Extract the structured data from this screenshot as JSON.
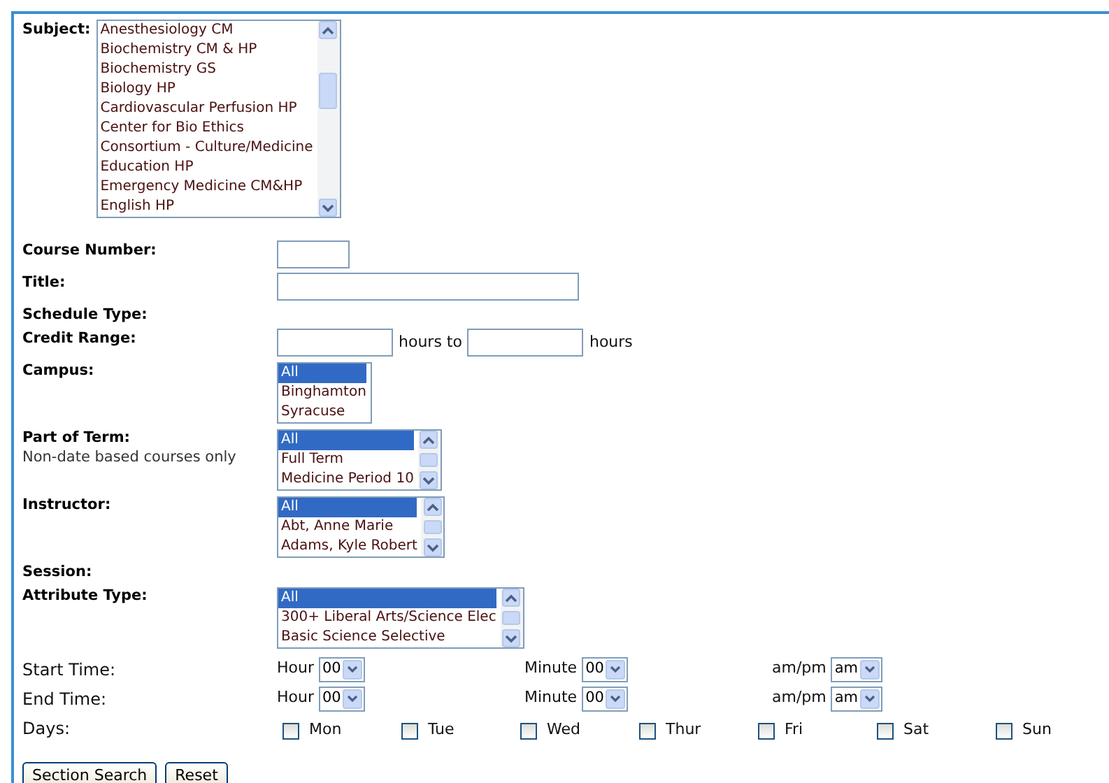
{
  "subject": {
    "label": "Subject:",
    "scrollable": true,
    "items": [
      {
        "text": "Anesthesiology CM",
        "selected": false
      },
      {
        "text": "Biochemistry CM & HP",
        "selected": false
      },
      {
        "text": "Biochemistry GS",
        "selected": false
      },
      {
        "text": "Biology HP",
        "selected": false
      },
      {
        "text": "Cardiovascular Perfusion HP",
        "selected": false
      },
      {
        "text": "Center for Bio Ethics",
        "selected": false
      },
      {
        "text": "Consortium - Culture/Medicine",
        "selected": false
      },
      {
        "text": "Education HP",
        "selected": false
      },
      {
        "text": "Emergency Medicine CM&HP",
        "selected": false
      },
      {
        "text": "English HP",
        "selected": false
      }
    ]
  },
  "fields": [
    {
      "kind": "short",
      "label": "Course Number:"
    },
    {
      "kind": "long",
      "label": "Title:"
    },
    {
      "kind": "none",
      "label": "Schedule Type:"
    },
    {
      "kind": "range",
      "label": "Credit Range:",
      "unit_1": "hours to",
      "unit_2": "hours"
    },
    {
      "kind": "listbox",
      "label": "Campus:",
      "scrollable": false,
      "items": [
        {
          "text": "All",
          "selected": true
        },
        {
          "text": "Binghamton",
          "selected": false
        },
        {
          "text": "Syracuse",
          "selected": false
        }
      ]
    },
    {
      "kind": "listbox",
      "label": "Part of Term:",
      "note": "Non-date based courses only",
      "scrollable": true,
      "items": [
        {
          "text": "All",
          "selected": true
        },
        {
          "text": "Full Term",
          "selected": false
        },
        {
          "text": "Medicine Period 10",
          "selected": false
        }
      ]
    },
    {
      "kind": "listbox",
      "label": "Instructor:",
      "scrollable": true,
      "items": [
        {
          "text": "All",
          "selected": true
        },
        {
          "text": "Abt, Anne Marie",
          "selected": false
        },
        {
          "text": "Adams, Kyle Robert",
          "selected": false
        }
      ]
    },
    {
      "kind": "none",
      "label": "Session:"
    },
    {
      "kind": "listbox",
      "label": "Attribute Type:",
      "scrollable": true,
      "items": [
        {
          "text": "All",
          "selected": true
        },
        {
          "text": "300+ Liberal Arts/Science Elec",
          "selected": false
        },
        {
          "text": "Basic Science Selective",
          "selected": false
        }
      ]
    }
  ],
  "time_rows": [
    {
      "label": "Start Time:",
      "selects": [
        {
          "label": "Hour",
          "value": "00"
        },
        {
          "label": "Minute",
          "value": "00"
        },
        {
          "label": "am/pm",
          "value": "am"
        }
      ]
    },
    {
      "label": "End Time:",
      "selects": [
        {
          "label": "Hour",
          "value": "00"
        },
        {
          "label": "Minute",
          "value": "00"
        },
        {
          "label": "am/pm",
          "value": "am"
        }
      ]
    }
  ],
  "days": {
    "label": "Days:",
    "items": [
      {
        "text": "Mon",
        "checked": false
      },
      {
        "text": "Tue",
        "checked": false
      },
      {
        "text": "Wed",
        "checked": false
      },
      {
        "text": "Thur",
        "checked": false
      },
      {
        "text": "Fri",
        "checked": false
      },
      {
        "text": "Sat",
        "checked": false
      },
      {
        "text": "Sun",
        "checked": false
      }
    ]
  },
  "buttons": [
    "Section Search",
    "Reset"
  ]
}
